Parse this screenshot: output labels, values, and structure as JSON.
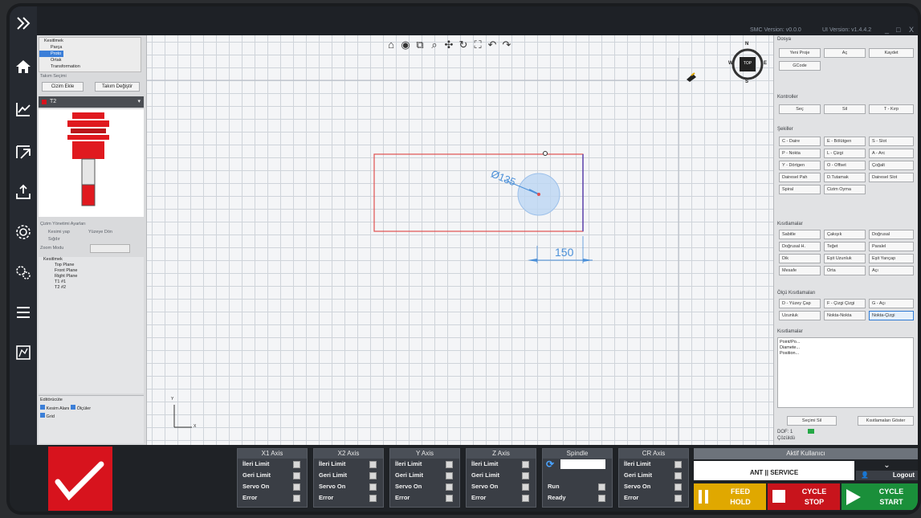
{
  "titlebar": {
    "smc_version": "SMC Version: v0.0.0",
    "ui_version": "UI Version: v1.4.4.2",
    "window_controls": [
      "_",
      "□",
      "X"
    ]
  },
  "sidebar": {
    "items": [
      "expand-icon",
      "home-icon",
      "chart-icon",
      "export-icon",
      "upload-icon",
      "gear-icon",
      "gears-icon",
      "list-icon",
      "machine-icon"
    ]
  },
  "left_panel": {
    "tree_items": [
      "Kesitlmek",
      "Parça",
      "Proto",
      "Ortak",
      "Transformation"
    ],
    "tool_section_label": "Takım Seçimi",
    "buttons": {
      "add": "Cizim Ekle",
      "change": "Takım Değiştir"
    },
    "tool_selected": "T2",
    "drawing_settings_label": "Çizim Yönetimi Ayarları",
    "options": [
      "Kesimi yap",
      "Yüzeye Dön",
      "Sığdır"
    ],
    "zoom_mode_label": "Zoom Modu",
    "feature_tree": [
      "Kesitlmek",
      "Top Plane",
      "Front Plane",
      "Right Plane",
      "T1 #1",
      "T2 #2"
    ],
    "bottom_label": "Editörücüte",
    "bottom_options": [
      "Kesim Alanı",
      "Ölçüler",
      "Grid"
    ]
  },
  "canvas": {
    "toolbar": [
      "⌂",
      "◉",
      "⧉",
      "⌕",
      "✣",
      "↻",
      "⛶",
      "↶",
      "↷"
    ],
    "dimension_diameter": "Ø135",
    "dimension_length": "150",
    "view_cube_label": "TOP",
    "compass": {
      "n": "N",
      "w": "W",
      "e": "E",
      "s": "S"
    },
    "axis_label": "Y",
    "axis_x": "X"
  },
  "right_panel": {
    "dosya": {
      "title": "Dosya",
      "buttons": [
        "Yeni Proje",
        "Aç",
        "Kaydet",
        "GCode"
      ]
    },
    "kontroller": {
      "title": "Kontroller",
      "buttons": [
        "Seç",
        "Sil",
        "T - Kırp"
      ]
    },
    "sekiller": {
      "title": "Şekiller",
      "buttons": [
        "C - Daire",
        "E - Bölütgen",
        "S - Slot",
        "P - Nokta",
        "L - Çizgi",
        "A - Arc",
        "Y - Dörtgen",
        "O - Offset",
        "Çoğalt",
        "Dairesel Pah",
        "D.Tutamak",
        "Dairesel Slot",
        "Spiral",
        "Cizim Oyma"
      ]
    },
    "kisitlamalar": {
      "title": "Kısıtlamalar",
      "buttons": [
        "Sabitle",
        "Çakışık",
        "Doğrusal",
        "Doğrusal H.",
        "Teğet",
        "Paralel",
        "Dik",
        "Eşit Uzunluk",
        "Eşit Yarıçap",
        "Mesafe",
        "Orta",
        "Açı"
      ]
    },
    "olcu": {
      "title": "Ölçü Kısıtlamaları",
      "buttons": [
        "D - Yüzey Çap",
        "F - Çizgi Çizgi",
        "G - Açı",
        "Uzunluk",
        "Nokta-Nokta",
        "Nokta-Çizgi"
      ]
    },
    "notes": {
      "title": "Kısıtlamalar",
      "lines": [
        "Point/Po...",
        "Diamete...",
        "Position..."
      ]
    },
    "bottom_buttons": [
      "Seçimi Sil",
      "Kısıtlamaları Göster"
    ],
    "dof": "DOF: 1",
    "status": "Çözüldü"
  },
  "axes": [
    {
      "name": "X1 Axis",
      "rows": [
        "İleri Limit",
        "Geri Limit",
        "Servo On",
        "Error"
      ]
    },
    {
      "name": "X2 Axis",
      "rows": [
        "İleri Limit",
        "Geri Limit",
        "Servo On",
        "Error"
      ]
    },
    {
      "name": "Y Axis",
      "rows": [
        "İleri Limit",
        "Geri Limit",
        "Servo On",
        "Error"
      ]
    },
    {
      "name": "Z Axis",
      "rows": [
        "İleri Limit",
        "Geri Limit",
        "Servo On",
        "Error"
      ]
    },
    {
      "name": "Spindle",
      "rows": [
        "",
        "",
        "Run",
        "Ready"
      ]
    },
    {
      "name": "CR Axis",
      "rows": [
        "İleri Limit",
        "Geri Limit",
        "Servo On",
        "Error"
      ]
    }
  ],
  "user": {
    "header": "Aktif Kullanıcı",
    "value": "ANT || SERVICE",
    "logout": "Logout"
  },
  "controls": {
    "feed_hold": [
      "FEED",
      "HOLD"
    ],
    "cycle_stop": [
      "CYCLE",
      "STOP"
    ],
    "cycle_start": [
      "CYCLE",
      "START"
    ]
  },
  "colors": {
    "accent": "#d7131d",
    "feed_hold": "#e0a800",
    "cycle_stop": "#c8141c",
    "cycle_start": "#1a8f3a"
  }
}
